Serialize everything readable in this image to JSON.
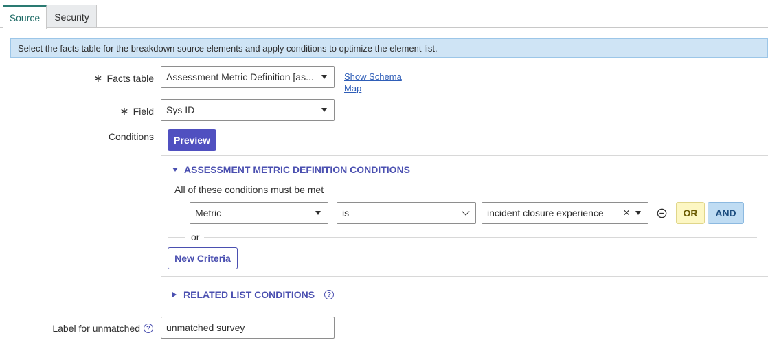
{
  "tabs": [
    {
      "label": "Source",
      "active": true
    },
    {
      "label": "Security",
      "active": false
    }
  ],
  "banner": {
    "text": "Select the facts table for the breakdown source elements and apply conditions to optimize the element list."
  },
  "form": {
    "facts_table": {
      "label": "Facts table",
      "required_mark": "∗",
      "value": "Assessment Metric Definition [as..."
    },
    "schema_link": {
      "line1": "Show Schema",
      "line2": "Map"
    },
    "field": {
      "label": "Field",
      "required_mark": "∗",
      "value": "Sys ID"
    },
    "conditions": {
      "label": "Conditions",
      "preview_label": "Preview"
    },
    "unmatched": {
      "label": "Label for unmatched",
      "value": "unmatched survey"
    }
  },
  "condition_builder": {
    "section_title": "ASSESSMENT METRIC DEFINITION CONDITIONS",
    "rule_text": "All of these conditions must be met",
    "row": {
      "field": "Metric",
      "operator": "is",
      "value": "incident closure experience",
      "clear": "×",
      "or_label": "OR",
      "and_label": "AND"
    },
    "or_separator": "or",
    "new_criteria_label": "New Criteria",
    "related_title": "RELATED LIST CONDITIONS"
  },
  "colors": {
    "accent": "#4a4fb0",
    "banner_bg": "#cfe4f5",
    "tab_active": "#2a7a72"
  }
}
